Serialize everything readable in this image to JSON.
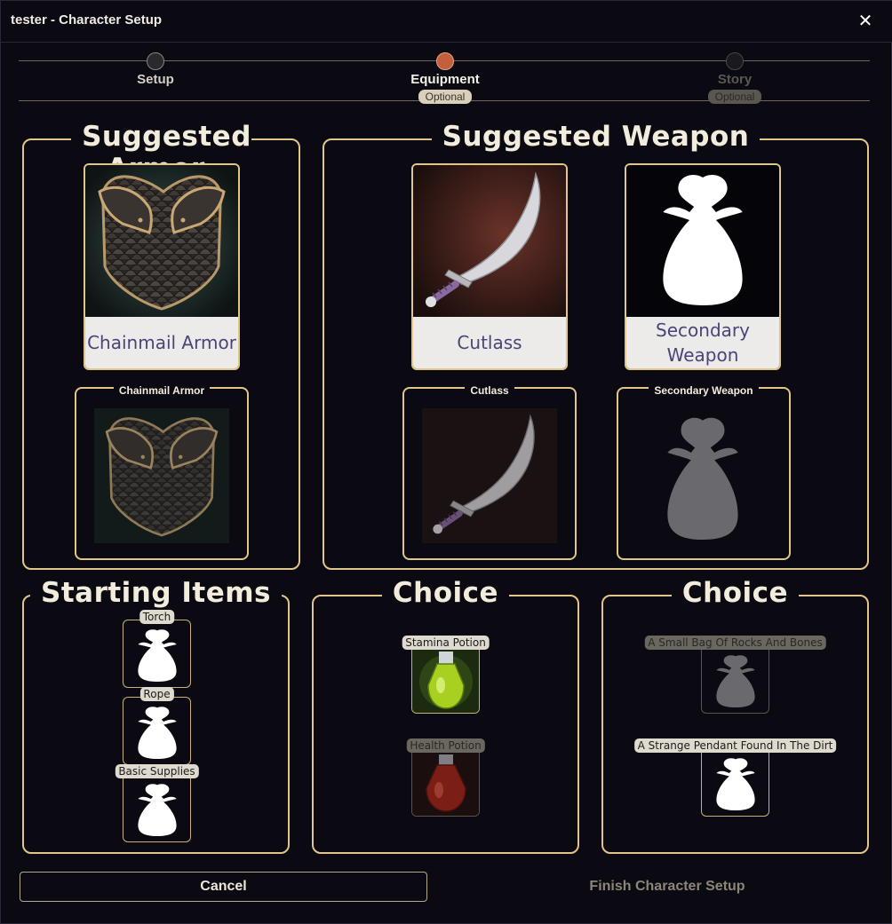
{
  "window": {
    "title": "tester - Character Setup",
    "close_label": "✕"
  },
  "stepper": {
    "steps": [
      {
        "label": "Setup",
        "optional": ""
      },
      {
        "label": "Equipment",
        "optional": "Optional"
      },
      {
        "label": "Story",
        "optional": "Optional"
      }
    ]
  },
  "armor": {
    "title": "Suggested Armor",
    "card_name": "Chainmail Armor",
    "slot_title": "Chainmail Armor"
  },
  "weapon": {
    "title": "Suggested Weapon",
    "primary_name": "Cutlass",
    "secondary_name": "Secondary Weapon",
    "primary_slot": "Cutlass",
    "secondary_slot": "Secondary Weapon"
  },
  "starting": {
    "title": "Starting Items",
    "items": [
      "Torch",
      "Rope",
      "Basic Supplies"
    ]
  },
  "choice1": {
    "title": "Choice",
    "options": [
      "Stamina Potion",
      "Health Potion"
    ]
  },
  "choice2": {
    "title": "Choice",
    "options": [
      "A Small Bag Of Rocks And Bones",
      "A Strange Pendant Found In The Dirt"
    ]
  },
  "footer": {
    "cancel": "Cancel",
    "finish": "Finish Character Setup"
  },
  "colors": {
    "accent": "#e0c68a",
    "active_step": "#c25f3f",
    "background": "#0b0a12"
  }
}
